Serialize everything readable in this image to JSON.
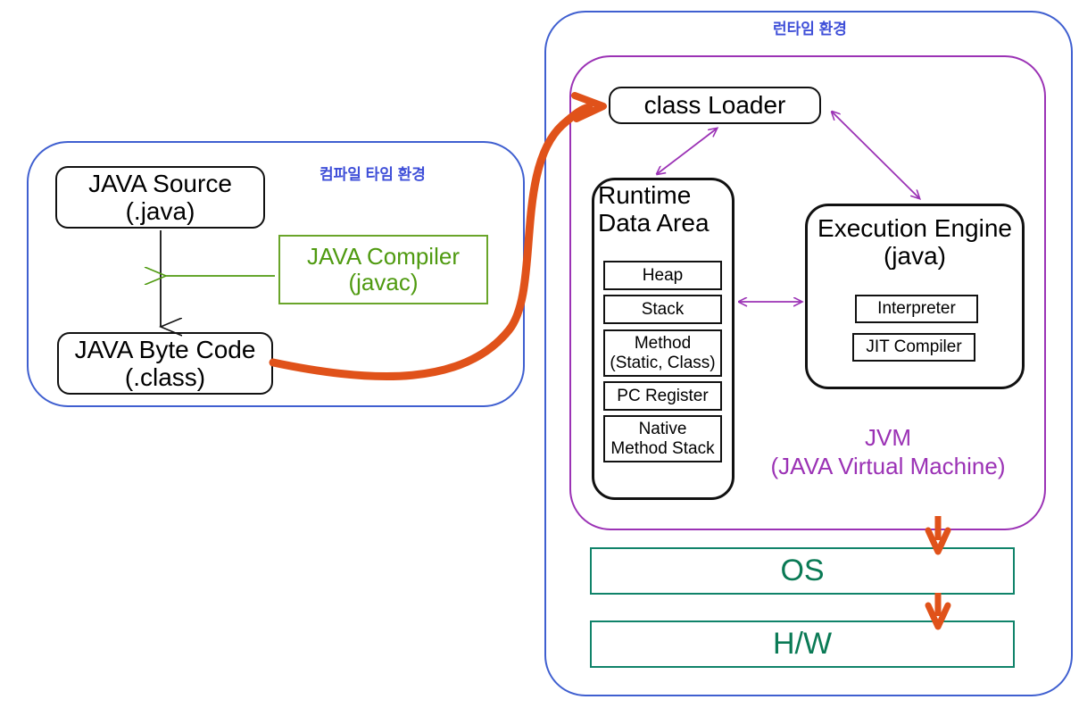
{
  "diagram": {
    "title": "Java compile-time and runtime environment",
    "colors": {
      "env_border": "#3f5fd0",
      "env_label": "#3f4fd8",
      "jvm_border": "#9b32b5",
      "jvm_label": "#9b32b5",
      "compiler_green": "#4f9a10",
      "compiler_border": "#6aa52a",
      "os_hw_text": "#0a7a55",
      "os_hw_border": "#10836a",
      "flow_arrow_orange": "#e0521a",
      "inner_arrow_purple": "#9b32b5",
      "black": "#111111"
    }
  },
  "compile_env": {
    "label": "컴파일 타임 환경",
    "source_box": {
      "line1": "JAVA Source",
      "line2": "(.java)"
    },
    "bytecode_box": {
      "line1": "JAVA Byte Code",
      "line2": "(.class)"
    },
    "compiler_box": {
      "line1": "JAVA Compiler",
      "line2": "(javac)"
    }
  },
  "runtime_env": {
    "label": "런타임 환경",
    "jvm": {
      "label_line1": "JVM",
      "label_line2": "(JAVA Virtual Machine)",
      "class_loader": {
        "label": "class Loader"
      },
      "runtime_data_area": {
        "title_line1": "Runtime",
        "title_line2": "Data Area",
        "items": [
          {
            "line1": "Heap",
            "line2": ""
          },
          {
            "line1": "Stack",
            "line2": ""
          },
          {
            "line1": "Method",
            "line2": "(Static, Class)"
          },
          {
            "line1": "PC Register",
            "line2": ""
          },
          {
            "line1": "Native",
            "line2": "Method Stack"
          }
        ]
      },
      "execution_engine": {
        "title_line1": "Execution Engine",
        "title_line2": "(java)",
        "items": [
          {
            "label": "Interpreter"
          },
          {
            "label": "JIT Compiler"
          }
        ]
      }
    },
    "platform": [
      {
        "label": "OS"
      },
      {
        "label": "H/W"
      }
    ]
  }
}
